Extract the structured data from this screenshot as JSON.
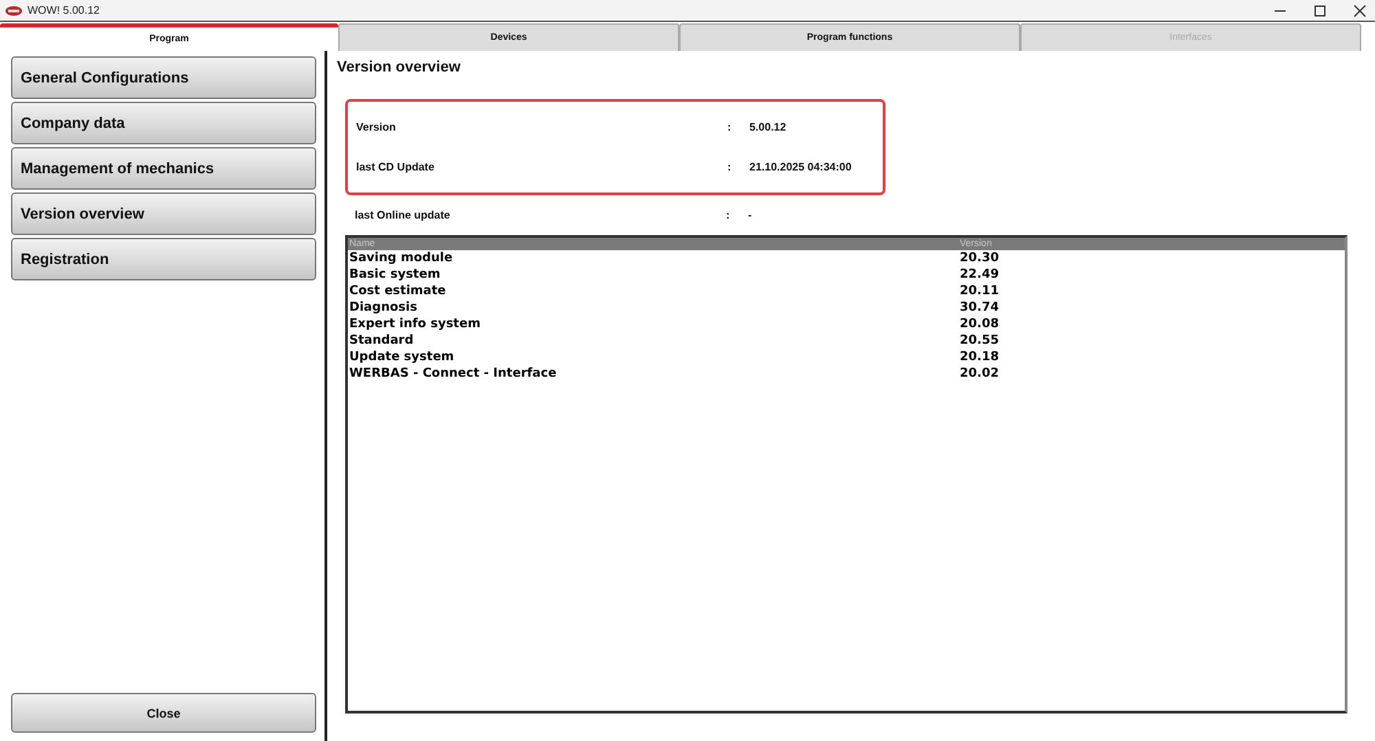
{
  "window": {
    "title": "WOW! 5.00.12"
  },
  "tabs": [
    {
      "label": "Program",
      "selected": true,
      "disabled": false
    },
    {
      "label": "Devices",
      "selected": false,
      "disabled": false
    },
    {
      "label": "Program functions",
      "selected": false,
      "disabled": false
    },
    {
      "label": "Interfaces",
      "selected": false,
      "disabled": true
    }
  ],
  "sidebar": {
    "items": [
      {
        "label": "General Configurations"
      },
      {
        "label": "Company data"
      },
      {
        "label": "Management of mechanics"
      },
      {
        "label": "Version overview"
      },
      {
        "label": "Registration"
      }
    ],
    "close_button": "Close"
  },
  "content": {
    "heading": "Version overview",
    "info_groups": [
      {
        "highlighted": true,
        "rows": [
          {
            "label": "Version",
            "separator": ":",
            "value": "5.00.12"
          },
          {
            "label": "last CD Update",
            "separator": ":",
            "value": "21.10.2025 04:34:00"
          }
        ]
      },
      {
        "highlighted": false,
        "rows": [
          {
            "label": "last Online update",
            "separator": ":",
            "value": "-"
          }
        ]
      }
    ],
    "table": {
      "columns": [
        "Name",
        "Version"
      ],
      "rows": [
        [
          "Saving module",
          "20.30"
        ],
        [
          "Basic system",
          "22.49"
        ],
        [
          "Cost estimate",
          "20.11"
        ],
        [
          "Diagnosis",
          "30.74"
        ],
        [
          "Expert info system",
          "20.08"
        ],
        [
          "Standard",
          "20.55"
        ],
        [
          "Update system",
          "20.18"
        ],
        [
          "WERBAS - Connect - Interface",
          "20.02"
        ]
      ]
    }
  }
}
